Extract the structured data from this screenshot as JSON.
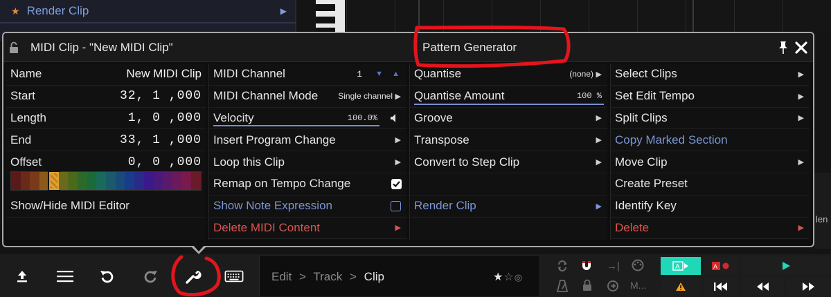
{
  "background": {
    "clip_row_label": "Render Clip",
    "right_edge_text": "len"
  },
  "popup": {
    "title": "MIDI Clip - \"New MIDI Clip\"",
    "subtitle": "Pattern Generator",
    "properties": {
      "name_label": "Name",
      "name_value": "New MIDI Clip",
      "start_label": "Start",
      "start_value": "32, 1 ,000",
      "length_label": "Length",
      "length_value": "1, 0 ,000",
      "end_label": "End",
      "end_value": "33, 1 ,000",
      "offset_label": "Offset",
      "offset_value": "0, 0 ,000",
      "show_hide_label": "Show/Hide MIDI Editor",
      "colors": [
        "#5a1a1a",
        "#6a2a1a",
        "#7a3a1a",
        "#8a5a1a",
        "#e0a030",
        "#6a6a1a",
        "#4a6a1a",
        "#2a6a2a",
        "#1a6a3a",
        "#1a6a5a",
        "#1a5a6a",
        "#1a4a7a",
        "#1a3a8a",
        "#2a2a8a",
        "#3a1a8a",
        "#4a1a7a",
        "#5a1a6a",
        "#6a1a5a",
        "#7a1a4a",
        "#6a1a2a"
      ],
      "selected_color_index": 4
    },
    "col2": {
      "midi_channel_label": "MIDI Channel",
      "midi_channel_value": "1",
      "midi_channel_mode_label": "MIDI Channel Mode",
      "midi_channel_mode_value": "Single channel",
      "velocity_label": "Velocity",
      "velocity_value": "100.0%",
      "insert_program_change_label": "Insert Program Change",
      "loop_clip_label": "Loop this Clip",
      "remap_tempo_label": "Remap on Tempo Change",
      "remap_tempo_checked": true,
      "show_note_expression_label": "Show Note Expression",
      "show_note_expression_checked": false,
      "delete_midi_content_label": "Delete MIDI Content"
    },
    "col3": {
      "quantise_label": "Quantise",
      "quantise_value": "(none)",
      "quantise_amount_label": "Quantise Amount",
      "quantise_amount_value": "100 %",
      "groove_label": "Groove",
      "transpose_label": "Transpose",
      "convert_step_label": "Convert to Step Clip",
      "render_clip_label": "Render Clip"
    },
    "col4": {
      "select_clips_label": "Select Clips",
      "set_edit_tempo_label": "Set Edit Tempo",
      "split_clips_label": "Split Clips",
      "copy_marked_label": "Copy Marked Section",
      "move_clip_label": "Move Clip",
      "create_preset_label": "Create Preset",
      "identify_key_label": "Identify Key",
      "delete_label": "Delete"
    }
  },
  "toolbar": {
    "breadcrumb_1": "Edit",
    "breadcrumb_2": "Track",
    "breadcrumb_3": "Clip",
    "breadcrumb_sep": ">",
    "metronome_short": "M..."
  },
  "colors": {
    "accent_blue": "#7a96d6",
    "danger_red": "#d9544f",
    "teal": "#20d8b8",
    "record_red": "#d8282a",
    "annotation_red": "#e4141c"
  }
}
